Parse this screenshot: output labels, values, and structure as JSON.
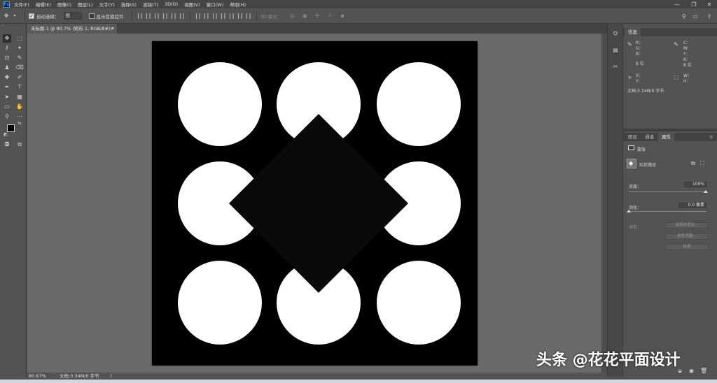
{
  "app": {
    "logo": "Ps",
    "menu": [
      "文件(F)",
      "编辑(E)",
      "图像(I)",
      "图层(L)",
      "文字(Y)",
      "选择(S)",
      "滤镜(T)",
      "3D(D)",
      "视图(V)",
      "窗口(W)",
      "帮助(H)"
    ],
    "window_controls": {
      "minimize": "—",
      "restore": "❐",
      "close": "✕"
    }
  },
  "options_bar": {
    "auto_select_label": "自动选择：",
    "auto_select_value": "组",
    "show_transform_label": "显示变换控件",
    "mode_3d_label": "3D 模式："
  },
  "document": {
    "tab_title": "未标题-1 @ 80.7% (矩形 1, RGB/8#) *",
    "tab_close": "×",
    "zoom": "80.67%",
    "doc_info": "文档:3.34M/0 字节",
    "canvas_background": "#000000",
    "shape_color": "#ffffff",
    "square_color": "#0a0a0a"
  },
  "info_panel": {
    "tab": "信息",
    "rgb_labels": [
      "R：",
      "G：",
      "B："
    ],
    "cmyk_labels": [
      "C：",
      "M：",
      "Y：",
      "K："
    ],
    "bit_left": "8 位",
    "bit_right": "8 位",
    "xy_labels": [
      "X：",
      "Y："
    ],
    "wh_labels": [
      "W：",
      "H："
    ],
    "doc_info": "文档:3.34M/0 字节"
  },
  "properties_panel": {
    "tabs": [
      "图层",
      "通道",
      "属性"
    ],
    "section": "蒙版",
    "shape_path_label": "形状路径",
    "density_label": "浓度：",
    "density_value": "100%",
    "density_fraction": 1.0,
    "feather_label": "羽化：",
    "feather_value": "0.0 像素",
    "feather_fraction": 0.0,
    "adjust_label": "调整：",
    "buttons": [
      "选择并遮住...",
      "颜色范围...",
      "反相"
    ]
  },
  "watermark": "头条 @花花平面设计"
}
